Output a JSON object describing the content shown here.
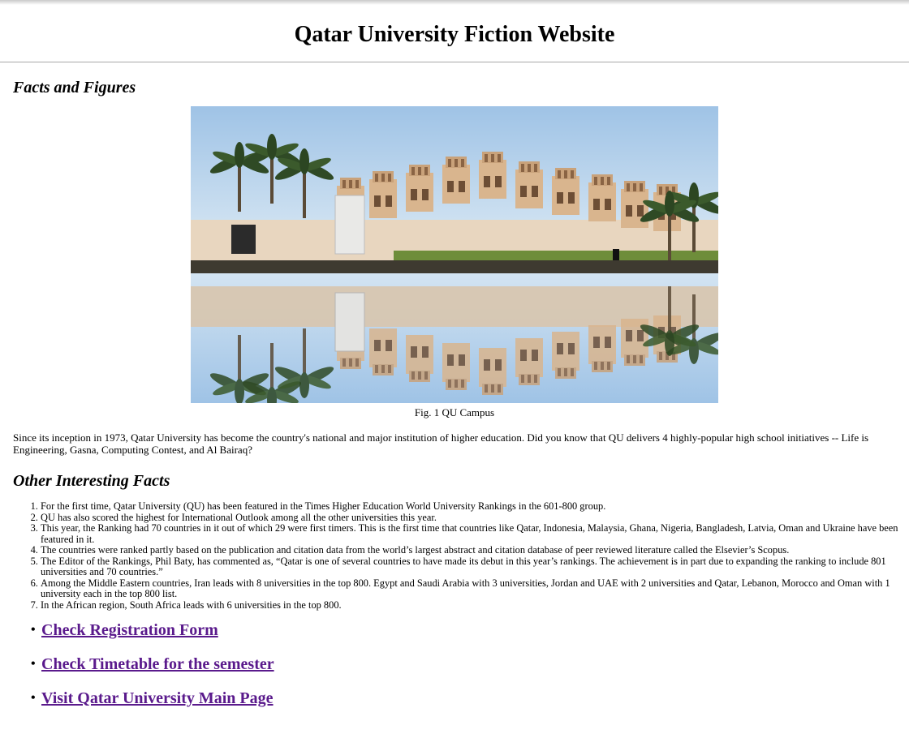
{
  "page": {
    "title": "Qatar University Fiction Website"
  },
  "facts": {
    "heading": "Facts and Figures",
    "image_alt": "QU campus buildings reflected in a pool",
    "caption": "Fig. 1 QU Campus",
    "intro": "Since its inception in 1973, Qatar University has become the country's national and major institution of higher education. Did you know that QU delivers 4 highly-popular high school initiatives -- Life is Engineering, Gasna, Computing Contest, and Al Bairaq?"
  },
  "other": {
    "heading": "Other Interesting Facts",
    "items": [
      "For the first time, Qatar University (QU) has been featured in the Times Higher Education World University Rankings in the 601-800 group.",
      "QU has also scored the highest for International Outlook among all the other universities this year.",
      "This year, the Ranking had 70 countries in it out of which 29 were first timers. This is the first time that countries like Qatar, Indonesia, Malaysia, Ghana, Nigeria, Bangladesh, Latvia, Oman and Ukraine have been featured in it.",
      "The countries were ranked partly based on the publication and citation data from the world’s largest abstract and citation database of peer reviewed literature called the Elsevier’s Scopus.",
      "The Editor of the Rankings, Phil Baty, has commented as, “Qatar is one of several countries to have made its debut in this year’s rankings. The achievement is in part due to expanding the ranking to include 801 universities and 70 countries.”",
      "Among the Middle Eastern countries, Iran leads with 8 universities in the top 800. Egypt and Saudi Arabia with 3 universities, Jordan and UAE with 2 universities and Qatar, Lebanon, Morocco and Oman with 1 university each in the top 800 list.",
      "In the African region, South Africa leads with 6 universities in the top 800."
    ]
  },
  "links": [
    {
      "label": "Check Registration Form"
    },
    {
      "label": "Check Timetable for the semester"
    },
    {
      "label": "Visit Qatar University Main Page"
    }
  ],
  "colors": {
    "link_visited": "#5a1a8c",
    "rule": "#a8a8a8"
  }
}
